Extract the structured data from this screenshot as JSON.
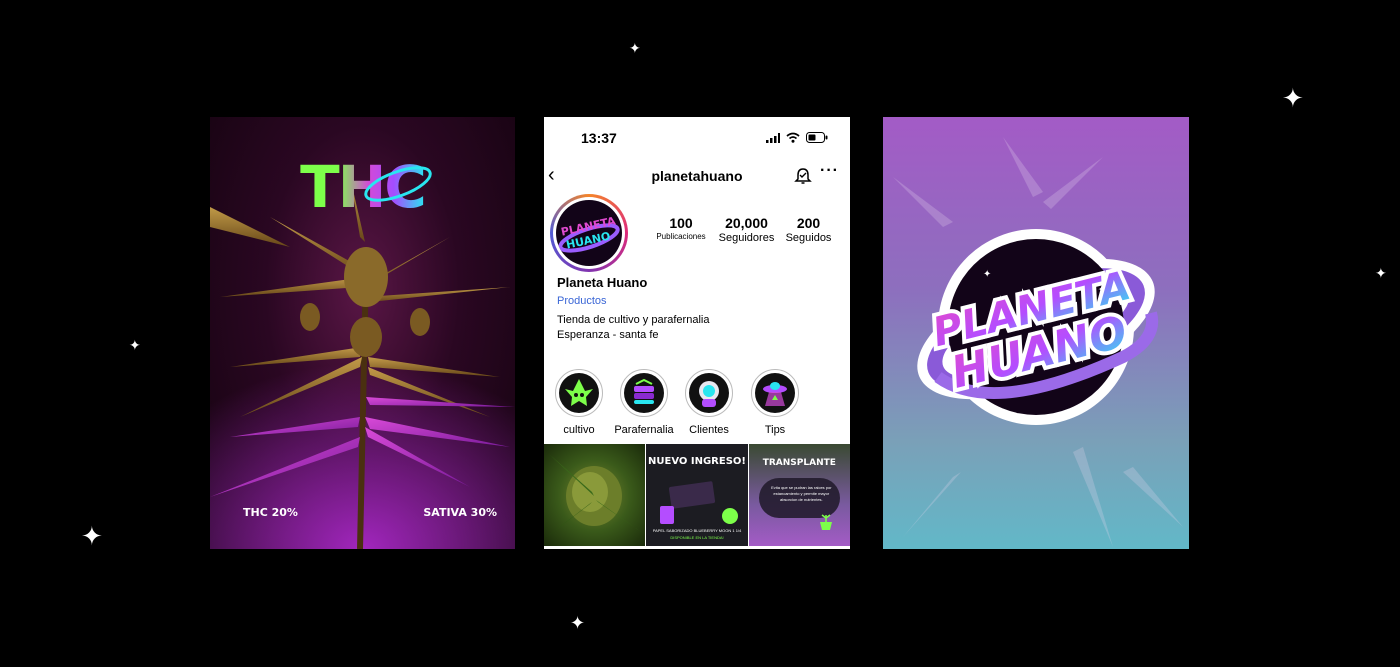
{
  "poster_left": {
    "title": "THC",
    "thc_label": "THC 20%",
    "sativa_label": "SATIVA 30%"
  },
  "phone": {
    "status_time": "13:37",
    "username": "planetahuano",
    "stats": [
      {
        "value": "100",
        "label": "Publicaciones"
      },
      {
        "value": "20,000",
        "label": "Seguidores"
      },
      {
        "value": "200",
        "label": "Seguidos"
      }
    ],
    "profile_name": "Planeta Huano",
    "category_link": "Productos",
    "bio_line1": "Tienda de cultivo y parafernalia",
    "bio_line2": "Esperanza - santa fe",
    "highlights": [
      {
        "label": "cultivo",
        "icon": "alien-plant-icon"
      },
      {
        "label": "Parafernalia",
        "icon": "grinder-icon"
      },
      {
        "label": "Clientes",
        "icon": "astronaut-icon"
      },
      {
        "label": "Tips",
        "icon": "ufo-icon"
      }
    ],
    "posts": [
      {
        "kind": "photo"
      },
      {
        "title": "NUEVO INGRESO!",
        "caption": "PAPEL SABORIZADO BLUEBERRY MOON 1 1/4",
        "sub": "DISPONIBLE EN LA TIENDA!"
      },
      {
        "title": "TRANSPLANTE",
        "caption": "Evita que se pudran las raices por estancamiento y permite mayor absorcion de nutrientes."
      }
    ]
  },
  "poster_right": {
    "logo_line1": "PLANETA",
    "logo_line2": "HUANO"
  },
  "colors": {
    "background": "#000000",
    "neon_green": "#7dff4a",
    "neon_purple": "#b44dff",
    "neon_cyan": "#29e6f0",
    "link_blue": "#3a66d6"
  }
}
